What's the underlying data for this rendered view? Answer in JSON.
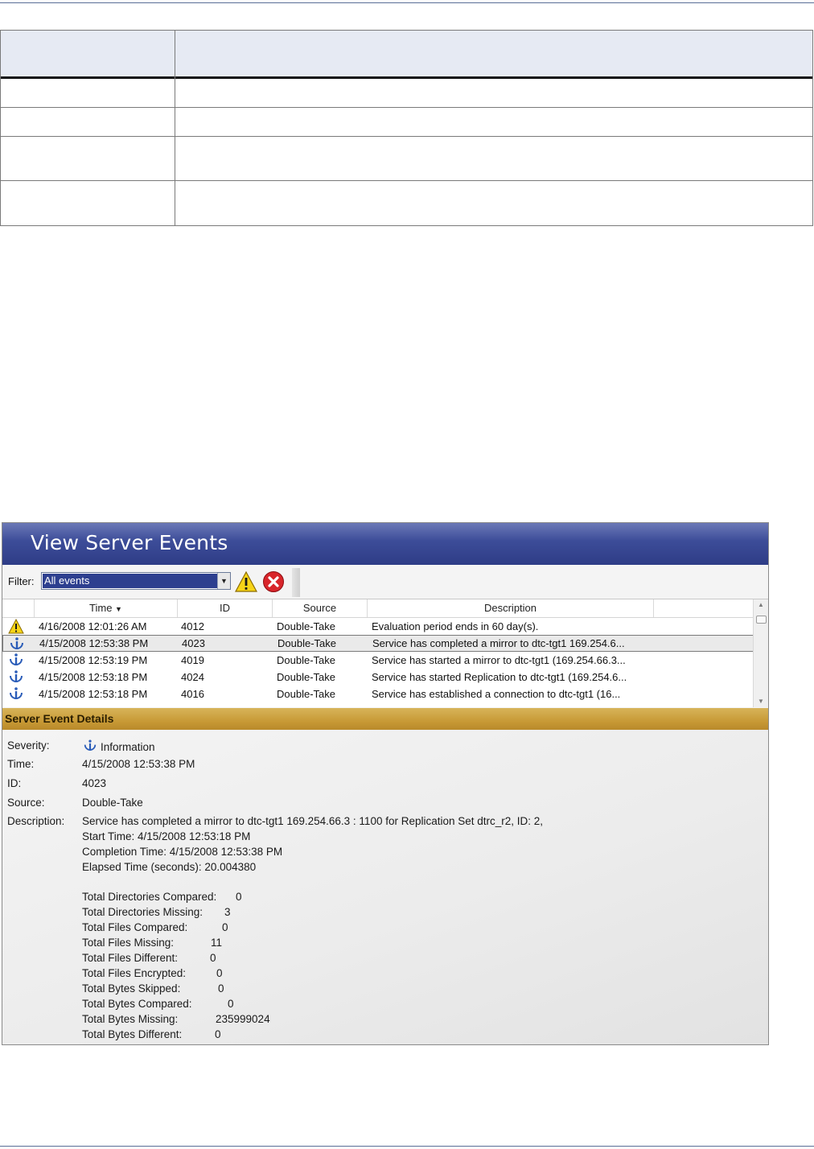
{
  "window": {
    "title": "View Server Events"
  },
  "toolbar": {
    "filter_label": "Filter:",
    "filter_value": "All events",
    "warning_icon": "warning-triangle-icon",
    "clear_icon": "red-x-circle-icon"
  },
  "grid": {
    "columns": [
      "Time",
      "ID",
      "Source",
      "Description"
    ],
    "sort_indicator": "▼",
    "rows": [
      {
        "icon": "warning",
        "time": "4/16/2008 12:01:26 AM",
        "id": "4012",
        "source": "Double-Take",
        "description": "Evaluation period ends in 60 day(s)."
      },
      {
        "icon": "info",
        "time": "4/15/2008 12:53:38 PM",
        "id": "4023",
        "source": "Double-Take",
        "description": "Service has completed a mirror to dtc-tgt1 169.254.6...",
        "selected": true
      },
      {
        "icon": "info",
        "time": "4/15/2008 12:53:19 PM",
        "id": "4019",
        "source": "Double-Take",
        "description": "Service has started a mirror to dtc-tgt1 (169.254.66.3..."
      },
      {
        "icon": "info",
        "time": "4/15/2008 12:53:18 PM",
        "id": "4024",
        "source": "Double-Take",
        "description": "Service has started Replication to dtc-tgt1 (169.254.6..."
      },
      {
        "icon": "info",
        "time": "4/15/2008 12:53:18 PM",
        "id": "4016",
        "source": "Double-Take",
        "description": "Service has established a connection to dtc-tgt1 (16..."
      }
    ]
  },
  "details": {
    "heading": "Server Event Details",
    "labels": {
      "severity": "Severity:",
      "time": "Time:",
      "id": "ID:",
      "source": "Source:",
      "description": "Description:"
    },
    "severity": "Information",
    "time": "4/15/2008 12:53:38 PM",
    "id": "4023",
    "source": "Double-Take",
    "description_lines": [
      "Service has completed a mirror to dtc-tgt1 169.254.66.3 : 1100 for Replication Set dtrc_r2, ID: 2,",
      "Start Time:  4/15/2008 12:53:18 PM",
      "Completion Time:  4/15/2008 12:53:38 PM",
      "Elapsed Time (seconds):  20.004380"
    ],
    "stats": [
      {
        "label": "Total Directories Compared:",
        "value": "0"
      },
      {
        "label": "Total Directories Missing:",
        "value": "3"
      },
      {
        "label": "Total Files Compared:",
        "value": "0"
      },
      {
        "label": "Total Files Missing:",
        "value": "11"
      },
      {
        "label": "Total Files Different:",
        "value": "0"
      },
      {
        "label": "Total Files Encrypted:",
        "value": "0"
      },
      {
        "label": "Total Bytes Skipped:",
        "value": "0"
      },
      {
        "label": "Total Bytes Compared:",
        "value": "0"
      },
      {
        "label": "Total Bytes Missing:",
        "value": "235999024"
      },
      {
        "label": "Total Bytes Different:",
        "value": "0"
      }
    ]
  },
  "colors": {
    "title_bar": "#3c4c98",
    "details_header": "#c89a36",
    "selection": "#2d3f8f"
  }
}
